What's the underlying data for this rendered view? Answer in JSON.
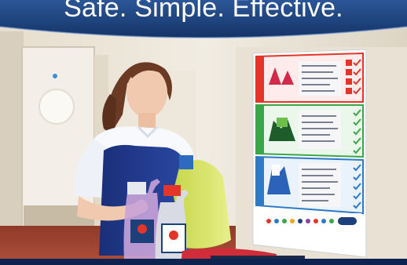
{
  "banner": {
    "tagline": "Safe. Simple. Effective."
  },
  "photo": {
    "subject": "cleaner-with-spray-bottles",
    "scene": "wall-chart-with-three-colour-zones"
  },
  "colors": {
    "banner_navy": "#1d3f7a",
    "wall": "#eae4d8",
    "floor": "#a0402f",
    "apron": "#1f3a8a",
    "zone_red": "#e4352b",
    "zone_green": "#3aa64a",
    "zone_blue": "#2f7ac8"
  }
}
